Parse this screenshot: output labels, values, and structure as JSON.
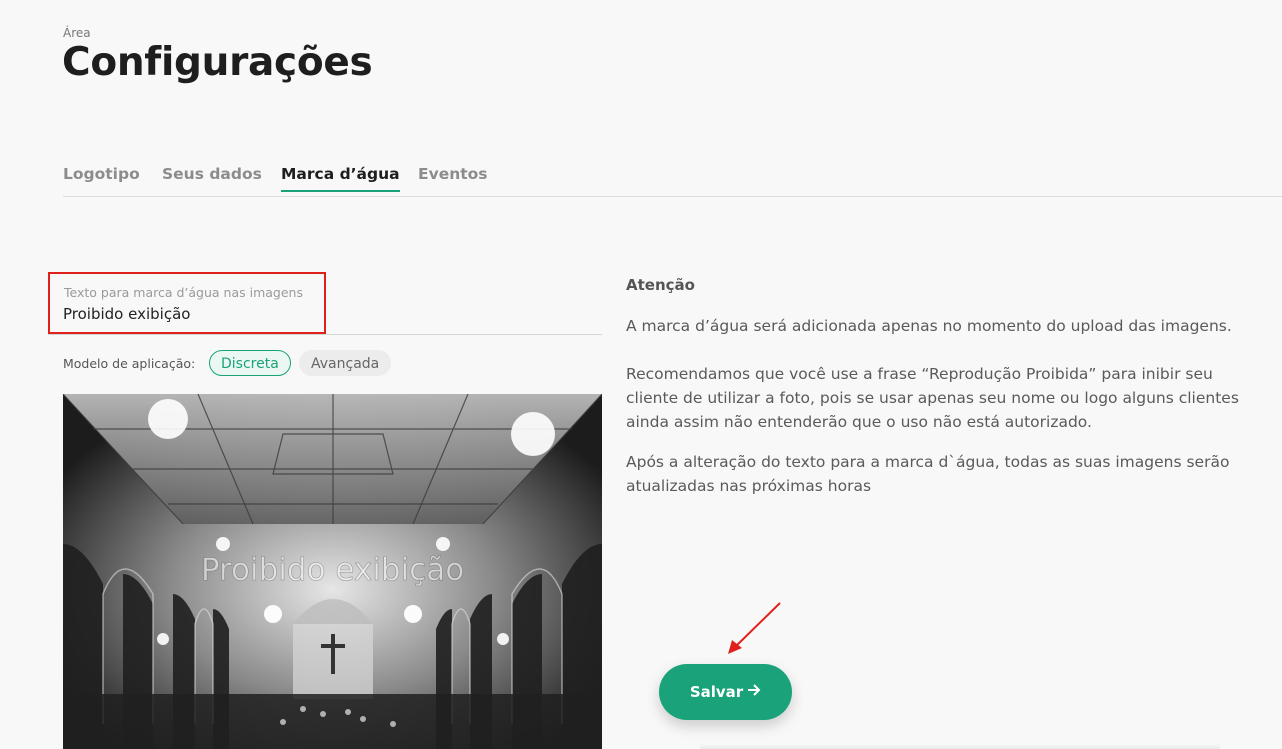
{
  "header": {
    "area_label": "Área",
    "title": "Configurações"
  },
  "tabs": [
    {
      "label": "Logotipo",
      "active": false
    },
    {
      "label": "Seus dados",
      "active": false
    },
    {
      "label": "Marca d’água",
      "active": true
    },
    {
      "label": "Eventos",
      "active": false
    }
  ],
  "watermark_form": {
    "field_label": "Texto para marca d’água nas imagens",
    "field_value": "Proibido exibição",
    "model_label": "Modelo de aplicação:",
    "options": [
      {
        "label": "Discreta",
        "selected": true
      },
      {
        "label": "Avançada",
        "selected": false
      }
    ],
    "preview_watermark_text": "Proibido exibição"
  },
  "info": {
    "title": "Atenção",
    "paragraphs": [
      "A marca d’água será adicionada apenas no momento do upload das imagens.",
      "Recomendamos que você use a frase “Reprodução Proibida” para inibir seu cliente de utilizar a foto, pois se usar apenas seu nome ou logo alguns clientes ainda assim não entenderão que o uso não está autorizado.",
      "Após a alteração do texto para a marca d`água, todas as suas imagens serão atualizadas nas próximas horas"
    ]
  },
  "actions": {
    "save_label": "Salvar",
    "save_icon": "arrow-right-icon"
  },
  "colors": {
    "accent": "#1aa37a",
    "highlight": "#e0201a",
    "background": "#f8f8f8"
  }
}
